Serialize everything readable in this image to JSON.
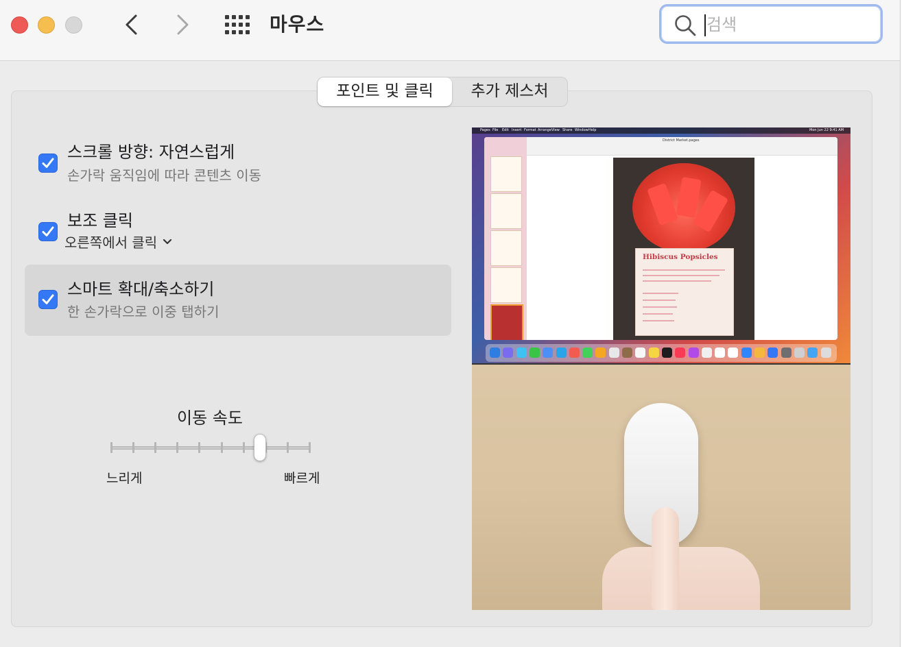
{
  "window": {
    "title": "마우스",
    "search_placeholder": "검색"
  },
  "tabs": [
    {
      "label": "포인트 및 클릭",
      "selected": true
    },
    {
      "label": "추가 제스처",
      "selected": false
    }
  ],
  "options": [
    {
      "title": "스크롤 방향: 자연스럽게",
      "subtitle": "손가락 움직임에 따라 콘텐츠 이동",
      "checked": true
    },
    {
      "title": "보조 클릭",
      "popup_value": "오른쪽에서 클릭",
      "checked": true
    },
    {
      "title": "스마트 확대/축소하기",
      "subtitle": "한 손가락으로 이중 탭하기",
      "checked": true
    }
  ],
  "tracking_speed": {
    "label": "이동 속도",
    "min_label": "느리게",
    "max_label": "빠르게",
    "tick_count": 10,
    "value_fraction": 0.75
  },
  "preview": {
    "menubar_items": [
      "Pages",
      "File",
      "Edit",
      "Insert",
      "Format",
      "Arrange",
      "View",
      "Share",
      "Window",
      "Help"
    ],
    "document_title": "District Market.pages",
    "menubar_clock": "Mon Jun 22  9:41 AM",
    "card_title": "Hibiscus Popsicles"
  },
  "colors": {
    "accent": "#3478f6",
    "close": "#ee5b57",
    "minimize": "#f5be4f",
    "zoom_disabled": "#d7d7d7"
  }
}
